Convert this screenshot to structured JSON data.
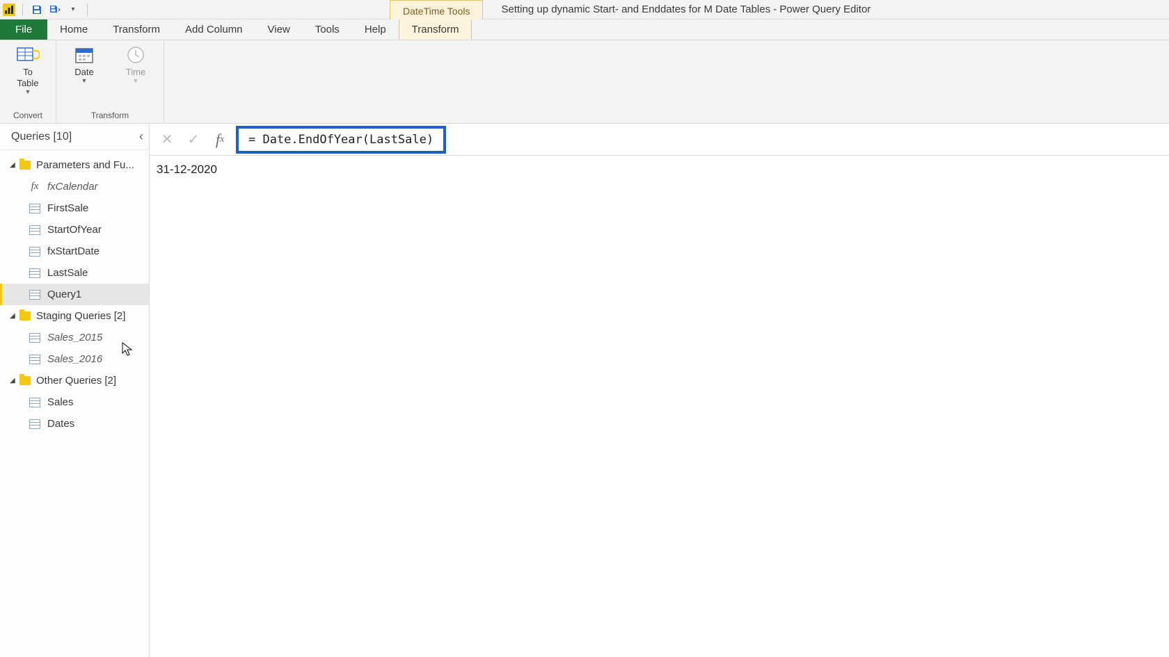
{
  "titlebar": {
    "tool_tab": "DateTime Tools",
    "window_title": "Setting up dynamic Start- and Enddates for M Date Tables - Power Query Editor"
  },
  "ribbon_tabs": {
    "file": "File",
    "home": "Home",
    "transform": "Transform",
    "add_column": "Add Column",
    "view": "View",
    "tools": "Tools",
    "help": "Help",
    "datetime_transform": "Transform"
  },
  "ribbon": {
    "convert_group_label": "Convert",
    "to_table_label": "To\nTable",
    "transform_group_label": "Transform",
    "date_label": "Date",
    "time_label": "Time"
  },
  "queries": {
    "title": "Queries [10]",
    "folder_params": "Parameters and Fu...",
    "items_params": {
      "fxCalendar": "fxCalendar",
      "FirstSale": "FirstSale",
      "StartOfYear": "StartOfYear",
      "fxStartDate": "fxStartDate",
      "LastSale": "LastSale",
      "Query1": "Query1"
    },
    "folder_staging": "Staging Queries [2]",
    "items_staging": {
      "Sales_2015": "Sales_2015",
      "Sales_2016": "Sales_2016"
    },
    "folder_other": "Other Queries [2]",
    "items_other": {
      "Sales": "Sales",
      "Dates": "Dates"
    }
  },
  "formula": {
    "expression": "= Date.EndOfYear(LastSale)",
    "result": "31-12-2020"
  }
}
